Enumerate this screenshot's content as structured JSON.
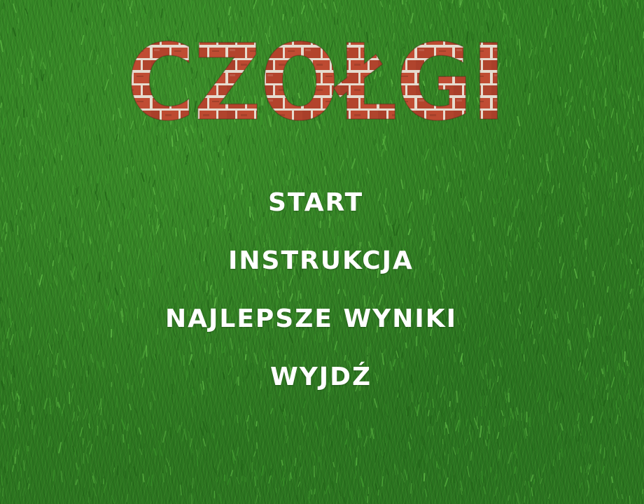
{
  "game": {
    "title": "CZOŁGI"
  },
  "menu": {
    "items": [
      {
        "label": "START"
      },
      {
        "label": "INSTRUKCJA"
      },
      {
        "label": "NAJLEPSZE WYNIKI"
      },
      {
        "label": "WYJDŹ"
      }
    ]
  },
  "colors": {
    "grass": "#2f7d22",
    "brick": "#b5452e",
    "mortar": "#e8ddd0",
    "menu_text": "#ffffff"
  },
  "icons": {
    "background": "grass-texture",
    "title_fill": "brick-texture"
  }
}
